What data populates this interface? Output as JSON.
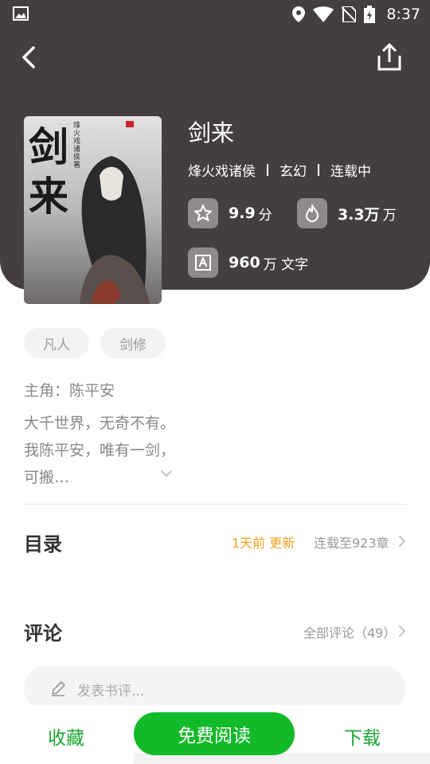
{
  "status_bar": {
    "time": "8:37"
  },
  "book": {
    "title": "剑来",
    "author": "烽火戏诸侯",
    "genre": "玄幻",
    "status": "连载中",
    "cover_title_chars": "剑来",
    "cover_subtitle": "烽火戏诸侯 著"
  },
  "stats": {
    "rating": "9.9",
    "rating_unit": "分",
    "popularity": "3.3万",
    "popularity_unit": "万",
    "words": "960",
    "words_unit": "万 文字"
  },
  "tags": [
    "凡人",
    "剑修"
  ],
  "protagonist": "主角：陈平安",
  "summary": "大千世界，无奇不有。我陈平安，唯有一剑，可搬…",
  "toc": {
    "title": "目录",
    "update": "1天前 更新",
    "chapters": "连载至923章"
  },
  "comments": {
    "title": "评论",
    "all": "全部评论（49）",
    "placeholder": "发表书评..."
  },
  "bottom": {
    "collect": "收藏",
    "read": "免费阅读",
    "download": "下载"
  },
  "colors": {
    "header_bg": "#443e43",
    "accent_green": "#12b928",
    "update_orange": "#f0a21c"
  }
}
